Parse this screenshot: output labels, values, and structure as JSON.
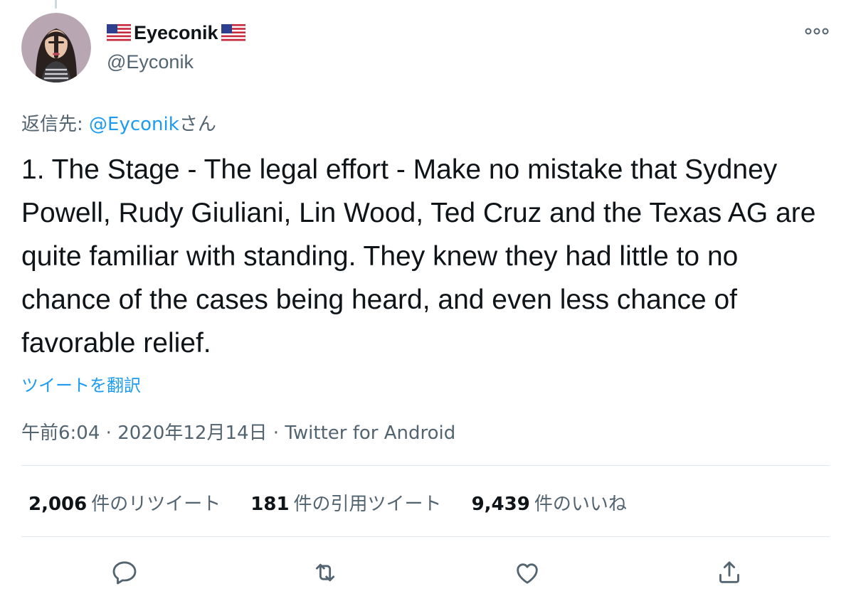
{
  "author": {
    "display_name": "Eyeconik",
    "handle": "@Eyconik",
    "flag_icon": "us-flag-icon"
  },
  "reply": {
    "prefix": "返信先: ",
    "target": "@Eyconik",
    "suffix": "さん"
  },
  "tweet": {
    "text": "1. The Stage - The legal effort - Make no mistake that Sydney Powell, Rudy Giuliani, Lin Wood, Ted Cruz and the Texas AG are quite familiar with standing. They knew they had little to no chance of the cases being heard, and even less chance of favorable relief."
  },
  "translate_label": "ツイートを翻訳",
  "meta": {
    "time": "午前6:04",
    "separator1": " · ",
    "date": "2020年12月14日",
    "separator2": " · ",
    "source": "Twitter for Android"
  },
  "stats": [
    {
      "count": "2,006",
      "label": "件のリツイート"
    },
    {
      "count": "181",
      "label": "件の引用ツイート"
    },
    {
      "count": "9,439",
      "label": "件のいいね"
    }
  ],
  "actions": [
    {
      "icon": "reply-icon"
    },
    {
      "icon": "retweet-icon"
    },
    {
      "icon": "like-icon"
    },
    {
      "icon": "share-icon"
    }
  ],
  "colors": {
    "accent": "#1d9bf0",
    "text": "#0f1419",
    "muted": "#536471"
  }
}
